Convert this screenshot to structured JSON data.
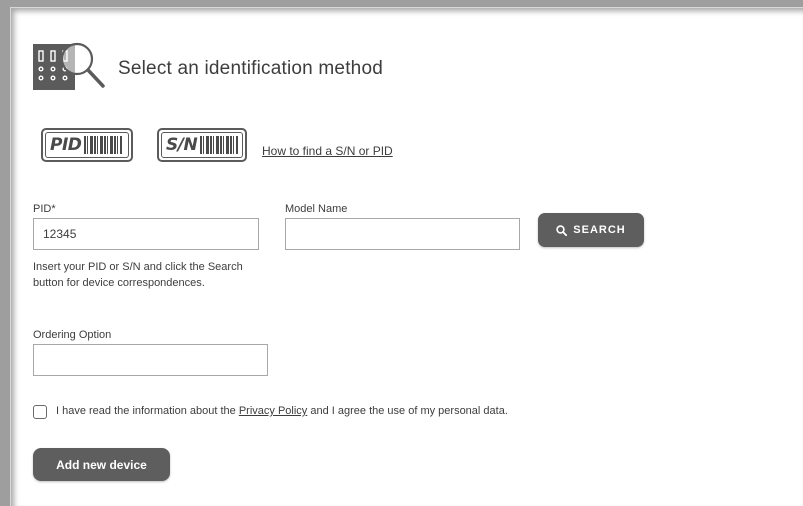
{
  "header": {
    "title": "Select an identification method",
    "icon": "device-search-icon"
  },
  "methods": {
    "pid_badge": "PID",
    "sn_badge": "S/N",
    "how_link": "How to find a S/N or PID"
  },
  "form": {
    "pid_label": "PID*",
    "pid_value": "12345",
    "model_label": "Model Name",
    "model_value": "",
    "search_label": "SEARCH",
    "hint": "Insert your PID or S/N and click the Search button for device correspondences.",
    "ordering_label": "Ordering Option",
    "ordering_value": ""
  },
  "consent": {
    "checked": false,
    "text_before": "I have read the information about the ",
    "link": "Privacy Policy",
    "text_after": " and I agree the use of my personal data."
  },
  "actions": {
    "add_label": "Add new device"
  },
  "colors": {
    "button_bg": "#5e5e5e",
    "text": "#3d3d3d",
    "frame": "#9e9e9e"
  }
}
